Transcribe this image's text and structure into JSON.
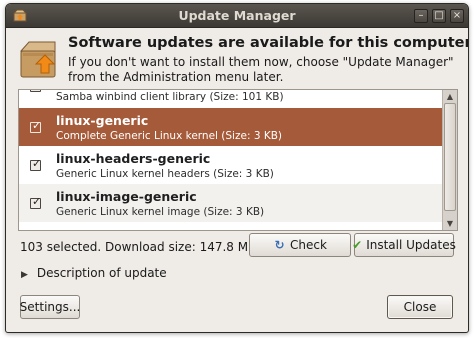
{
  "window": {
    "title": "Update Manager"
  },
  "header": {
    "title": "Software updates are available for this computer",
    "description": "If you don't want to install them now, choose \"Update Manager\" from the Administration menu later."
  },
  "updates": [
    {
      "name": "",
      "description": "Samba winbind client library (Size: 101 KB)",
      "checked": true,
      "selected": false,
      "partial": true
    },
    {
      "name": "linux-generic",
      "description": "Complete Generic Linux kernel (Size: 3 KB)",
      "checked": true,
      "selected": true
    },
    {
      "name": "linux-headers-generic",
      "description": "Generic Linux kernel headers (Size: 3 KB)",
      "checked": true,
      "selected": false
    },
    {
      "name": "linux-image-generic",
      "description": "Generic Linux kernel image (Size: 3 KB)",
      "checked": true,
      "selected": false
    }
  ],
  "summary": "103 selected. Download size: 147.8 MB",
  "buttons": {
    "check": "Check",
    "install": "Install Updates",
    "settings": "Settings...",
    "close": "Close"
  },
  "expander": {
    "label": "Description of update",
    "expanded": false
  },
  "colors": {
    "selection": "#a55a3a",
    "titlebar": "#3c3934",
    "window_bg": "#efebe7"
  },
  "icons": {
    "app": "package-update-icon",
    "check": "refresh-icon",
    "install": "checkmark-icon"
  }
}
